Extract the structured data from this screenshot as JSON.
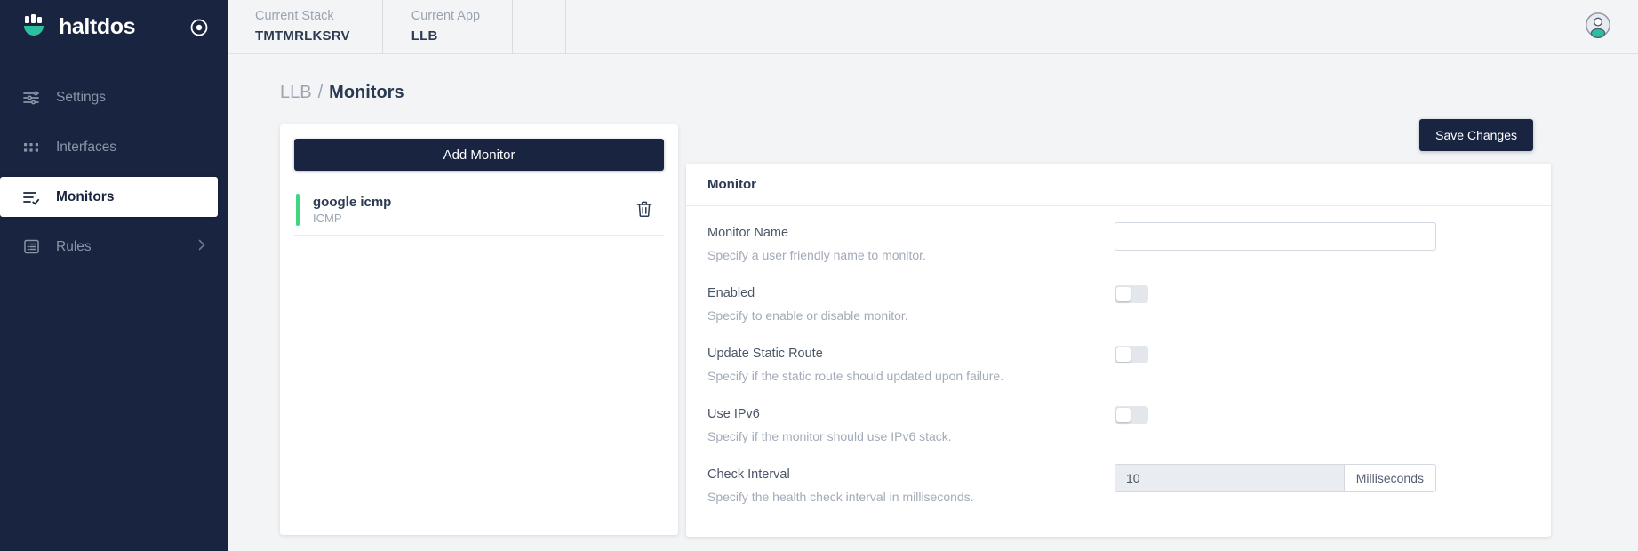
{
  "brand": {
    "name": "haltdos",
    "logo_icon": "haltdos-logo-icon",
    "target_icon": "target-icon"
  },
  "sidebar": {
    "items": [
      {
        "label": "Settings",
        "icon": "sliders-icon",
        "active": false,
        "chevron": false
      },
      {
        "label": "Interfaces",
        "icon": "grid-dots-icon",
        "active": false,
        "chevron": false
      },
      {
        "label": "Monitors",
        "icon": "list-check-icon",
        "active": true,
        "chevron": false
      },
      {
        "label": "Rules",
        "icon": "list-box-icon",
        "active": false,
        "chevron": true
      }
    ]
  },
  "topbar": {
    "contexts": [
      {
        "label": "Current Stack",
        "value": "TMTMRLKSRV"
      },
      {
        "label": "Current App",
        "value": "LLB"
      }
    ],
    "avatar_icon": "user-avatar-icon"
  },
  "breadcrumb": {
    "parent": "LLB",
    "separator": "/",
    "current": "Monitors"
  },
  "list_panel": {
    "add_button": "Add Monitor",
    "monitors": [
      {
        "name": "google icmp",
        "type": "ICMP",
        "status_color": "#3ed67f",
        "delete_icon": "trash-icon"
      }
    ]
  },
  "form": {
    "save_button": "Save Changes",
    "header": "Monitor",
    "fields": [
      {
        "label": "Monitor Name",
        "desc": "Specify a user friendly name to monitor.",
        "control": "text",
        "value": "",
        "placeholder": ""
      },
      {
        "label": "Enabled",
        "desc": "Specify to enable or disable monitor.",
        "control": "toggle",
        "value": "off"
      },
      {
        "label": "Update Static Route",
        "desc": "Specify if the static route should updated upon failure.",
        "control": "toggle",
        "value": "off"
      },
      {
        "label": "Use IPv6",
        "desc": "Specify if the monitor should use IPv6 stack.",
        "control": "toggle",
        "value": "off"
      },
      {
        "label": "Check Interval",
        "desc": "Specify the health check interval in milliseconds.",
        "control": "input-group",
        "value": "10",
        "addon": "Milliseconds"
      }
    ]
  },
  "colors": {
    "sidebar_bg": "#192440",
    "page_bg": "#f2f4f5",
    "accent_teal": "#2bbfa0",
    "status_green": "#3ed67f",
    "text_dark": "#2c3a52",
    "text_muted": "#9aa4b2"
  }
}
